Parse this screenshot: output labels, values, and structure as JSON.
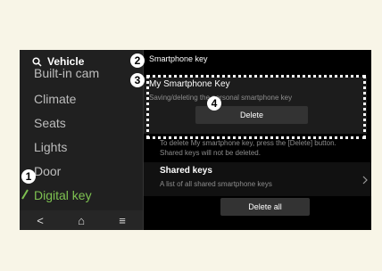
{
  "sidebar": {
    "search_label": "Vehicle",
    "items": [
      {
        "label": "Built-in cam"
      },
      {
        "label": "Climate"
      },
      {
        "label": "Seats"
      },
      {
        "label": "Lights"
      },
      {
        "label": "Door"
      },
      {
        "label": "Digital key"
      }
    ],
    "nav": {
      "back": "<",
      "home": "⌂",
      "menu": "≡"
    }
  },
  "main": {
    "title": "Smartphone key",
    "my_key": {
      "title": "My Smartphone Key",
      "subtitle": "Saving/deleting the personal smartphone key",
      "delete_label": "Delete"
    },
    "hint_lines": [
      "To delete My smartphone key, press the [Delete] button.",
      "Shared keys will not be deleted."
    ],
    "shared_keys": {
      "title": "Shared keys",
      "subtitle": "A list of all shared smartphone keys"
    },
    "delete_all_label": "Delete all"
  },
  "callouts": [
    "1",
    "2",
    "3",
    "4"
  ],
  "colors": {
    "active": "#7ec251",
    "screen_bg": "#000000",
    "page_bg": "#f8f5e7"
  }
}
